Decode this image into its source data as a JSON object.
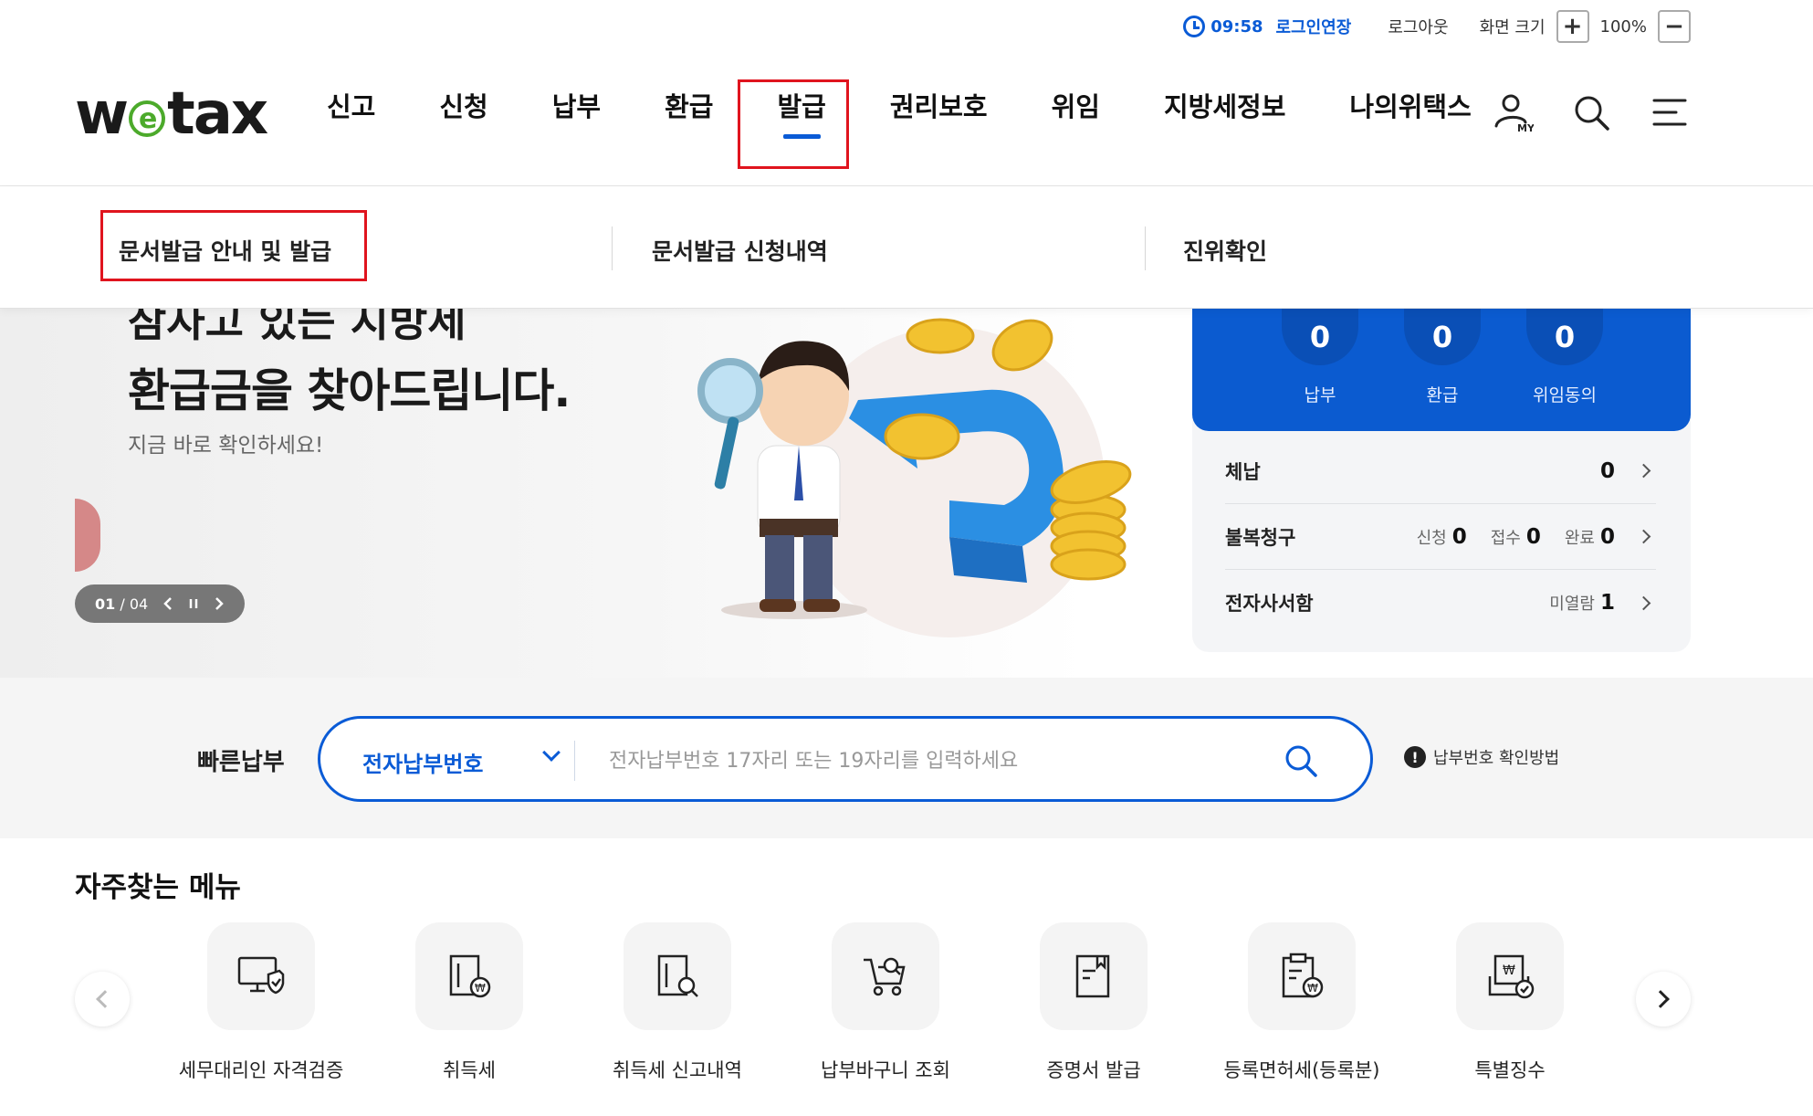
{
  "util": {
    "time": "09:58",
    "extend_login": "로그인연장",
    "logout": "로그아웃",
    "zoom_label": "화면 크기",
    "zoom_in": "+",
    "zoom_value": "100%",
    "zoom_out": "−"
  },
  "header": {
    "logo_w": "w",
    "logo_e": "e",
    "logo_tax": "tax",
    "nav": [
      "신고",
      "신청",
      "납부",
      "환급",
      "발급",
      "권리보호",
      "위임",
      "지방세정보",
      "나의위택스"
    ],
    "my_label": "MY"
  },
  "submenu": {
    "items": [
      "문서발급 안내 및 발급",
      "문서발급 신청내역",
      "진위확인"
    ]
  },
  "hero": {
    "title_cut": "잠자고 있는 지방세",
    "title": "환급금을 찾아드립니다.",
    "subtitle": "지금 바로 확인하세요!",
    "slide_current": "01",
    "slide_total": "/ 04"
  },
  "status": {
    "stats": [
      {
        "value": "0",
        "label": "납부"
      },
      {
        "value": "0",
        "label": "환급"
      },
      {
        "value": "0",
        "label": "위임동의"
      }
    ],
    "arrears": {
      "title": "체납",
      "value": "0"
    },
    "appeal": {
      "title": "불복청구",
      "apply_label": "신청",
      "apply": "0",
      "receipt_label": "접수",
      "receipt": "0",
      "done_label": "완료",
      "done": "0"
    },
    "mailbox": {
      "title": "전자사서함",
      "unread_label": "미열람",
      "unread": "1"
    }
  },
  "quickpay": {
    "label": "빠른납부",
    "select_value": "전자납부번호",
    "placeholder": "전자납부번호 17자리 또는 19자리를 입력하세요",
    "help_icon": "!",
    "help": "납부번호 확인방법"
  },
  "favorites": {
    "title": "자주찾는 메뉴",
    "items": [
      {
        "label": "세무대리인 자격검증",
        "icon": "monitor-shield-icon"
      },
      {
        "label": "취득세",
        "icon": "building-won-icon"
      },
      {
        "label": "취득세 신고내역",
        "icon": "building-search-icon"
      },
      {
        "label": "납부바구니 조회",
        "icon": "cart-search-icon"
      },
      {
        "label": "증명서 발급",
        "icon": "certificate-icon"
      },
      {
        "label": "등록면허세(등록분)",
        "icon": "clipboard-won-icon"
      },
      {
        "label": "특별징수",
        "icon": "document-check-icon"
      }
    ]
  },
  "colors": {
    "accent": "#0a5bd6",
    "card_blue": "#0b5bd0",
    "highlight": "#e0141e",
    "logo_green": "#4caa2b"
  }
}
